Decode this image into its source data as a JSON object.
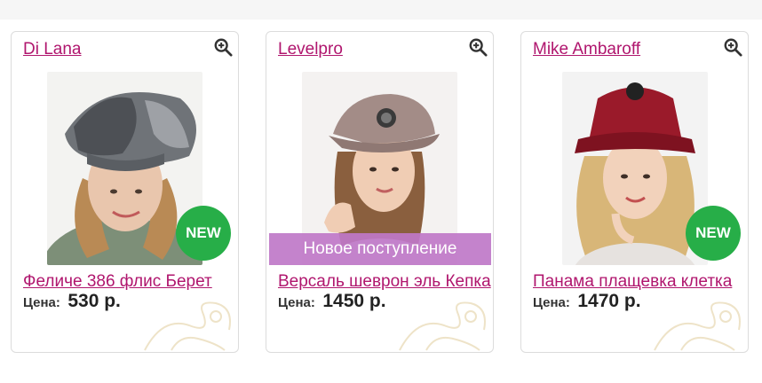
{
  "products": [
    {
      "brand": "Di Lana",
      "title": "Феличе 386 флис Берет",
      "price_label": "Цена:",
      "price_value": "530 р.",
      "badge": "NEW"
    },
    {
      "brand": "Levelpro",
      "title": "Версаль шеврон эль Кепка",
      "price_label": "Цена:",
      "price_value": "1450 р.",
      "banner": "Новое поступление"
    },
    {
      "brand": "Mike Ambaroff",
      "title": "Панама плащевка клетка",
      "price_label": "Цена:",
      "price_value": "1470 р.",
      "badge": "NEW"
    }
  ],
  "colors": {
    "link": "#b0166e",
    "badge_green": "#27ae48",
    "banner_purple": "#bf78c8"
  },
  "icons": {
    "zoom": "zoom-in-icon"
  }
}
